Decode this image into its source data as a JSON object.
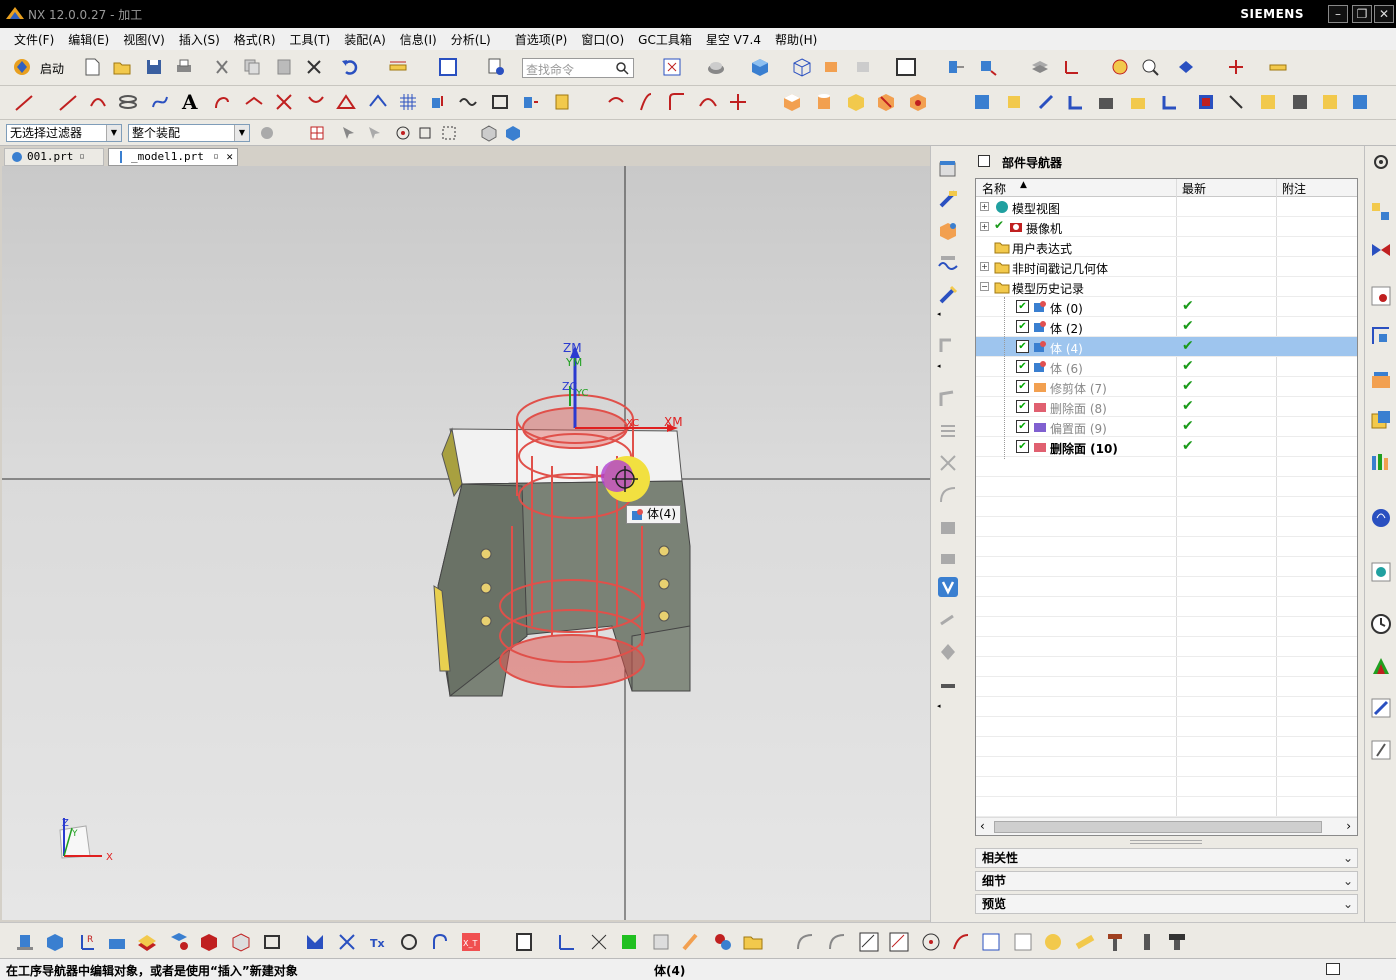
{
  "title": "NX 12.0.0.27 - 加工",
  "brand": "SIEMENS",
  "window_controls": [
    "–",
    "❐",
    "✕"
  ],
  "menu": [
    "文件(F)",
    "编辑(E)",
    "视图(V)",
    "插入(S)",
    "格式(R)",
    "工具(T)",
    "装配(A)",
    "信息(I)",
    "分析(L)",
    "首选项(P)",
    "窗口(O)",
    "GC工具箱",
    "星空 V7.4",
    "帮助(H)"
  ],
  "toolbar": {
    "start_label": "启动",
    "search_placeholder": "查找命令"
  },
  "filters": {
    "selection_filter": "无选择过滤器",
    "assembly_scope": "整个装配"
  },
  "tabs": [
    {
      "label": "001.prt"
    },
    {
      "label": "_model1.prt"
    }
  ],
  "viewport": {
    "wcs_labels": [
      "ZM",
      "YM",
      "ZC",
      "YC",
      "XC",
      "XM"
    ],
    "triad_labels": [
      "Z",
      "Y",
      "X"
    ],
    "tooltip": "体(4)"
  },
  "navigator": {
    "title": "部件导航器",
    "columns": [
      "名称",
      "最新",
      "附注"
    ],
    "rows": [
      {
        "label": "模型视图",
        "depth": 0,
        "expander": "+",
        "icon": "model-views-icon",
        "checkbox": false,
        "latest": false,
        "selected": false,
        "dim": false,
        "bold": false
      },
      {
        "label": "摄像机",
        "depth": 0,
        "expander": "+",
        "icon": "camera-icon",
        "checkbox": false,
        "latest": false,
        "selected": false,
        "dim": false,
        "bold": false
      },
      {
        "label": "用户表达式",
        "depth": 0,
        "expander": "",
        "icon": "folder-icon",
        "checkbox": false,
        "latest": false,
        "selected": false,
        "dim": false,
        "bold": false
      },
      {
        "label": "非时间戳记几何体",
        "depth": 0,
        "expander": "+",
        "icon": "folder-icon",
        "checkbox": false,
        "latest": false,
        "selected": false,
        "dim": false,
        "bold": false
      },
      {
        "label": "模型历史记录",
        "depth": 0,
        "expander": "−",
        "icon": "folder-open-icon",
        "checkbox": false,
        "latest": false,
        "selected": false,
        "dim": false,
        "bold": false
      },
      {
        "label": "体 (0)",
        "depth": 1,
        "expander": "",
        "icon": "body-icon",
        "checkbox": true,
        "latest": true,
        "selected": false,
        "dim": false,
        "bold": false
      },
      {
        "label": "体 (2)",
        "depth": 1,
        "expander": "",
        "icon": "body-icon",
        "checkbox": true,
        "latest": true,
        "selected": false,
        "dim": false,
        "bold": false
      },
      {
        "label": "体 (4)",
        "depth": 1,
        "expander": "",
        "icon": "body-icon",
        "checkbox": true,
        "latest": true,
        "selected": true,
        "dim": true,
        "bold": false
      },
      {
        "label": "体 (6)",
        "depth": 1,
        "expander": "",
        "icon": "body-icon",
        "checkbox": true,
        "latest": true,
        "selected": false,
        "dim": true,
        "bold": false
      },
      {
        "label": "修剪体 (7)",
        "depth": 1,
        "expander": "",
        "icon": "trim-body-icon",
        "checkbox": true,
        "latest": true,
        "selected": false,
        "dim": true,
        "bold": false
      },
      {
        "label": "删除面 (8)",
        "depth": 1,
        "expander": "",
        "icon": "delete-face-icon",
        "checkbox": true,
        "latest": true,
        "selected": false,
        "dim": true,
        "bold": false
      },
      {
        "label": "偏置面 (9)",
        "depth": 1,
        "expander": "",
        "icon": "offset-face-icon",
        "checkbox": true,
        "latest": true,
        "selected": false,
        "dim": true,
        "bold": false
      },
      {
        "label": "删除面 (10)",
        "depth": 1,
        "expander": "",
        "icon": "delete-face-icon",
        "checkbox": true,
        "latest": true,
        "selected": false,
        "dim": false,
        "bold": true
      }
    ],
    "sections": [
      "相关性",
      "细节",
      "预览"
    ]
  },
  "status": {
    "message": "在工序导航器中编辑对象，或者是使用“插入”新建对象",
    "selection": "体(4)"
  },
  "colors": {
    "titlebar": "#000000",
    "selection": "#9ec5ee",
    "wireframe": "#e0504a",
    "body": "#7a8276",
    "check": "#1a9a1a"
  }
}
